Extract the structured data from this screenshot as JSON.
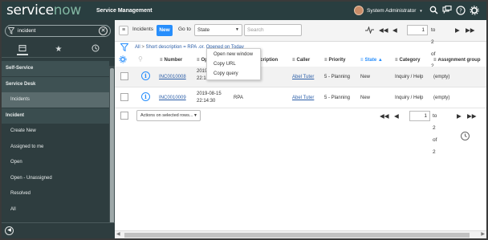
{
  "topbar": {
    "logo_white": "service",
    "logo_green": "now",
    "product": "Service Management",
    "user_name": "System Administrator",
    "user_caret": "▾",
    "icons": [
      "search-icon",
      "chat-icon",
      "help-icon",
      "gear-icon"
    ],
    "brand_colors": {
      "bar": "#293e40",
      "logo_accent": "#81b5a1"
    }
  },
  "sidebar": {
    "filter_value": "incident",
    "tabs": [
      "all-apps-icon",
      "favorites-icon",
      "history-icon"
    ],
    "items": [
      {
        "label": "Self-Service",
        "kind": "section"
      },
      {
        "label": "Service Desk",
        "kind": "section"
      },
      {
        "label": "Incidents",
        "kind": "selected"
      },
      {
        "label": "Incident",
        "kind": "header"
      },
      {
        "label": "Create New",
        "kind": "module"
      },
      {
        "label": "Assigned to me",
        "kind": "module"
      },
      {
        "label": "Open",
        "kind": "module"
      },
      {
        "label": "Open - Unassigned",
        "kind": "module"
      },
      {
        "label": "Resolved",
        "kind": "module"
      },
      {
        "label": "All",
        "kind": "module"
      }
    ]
  },
  "list": {
    "title": "Incidents",
    "new_label": "New",
    "goto_label": "Go to",
    "goto_field": "State",
    "search_placeholder": "Search",
    "page_current": "1",
    "page_total": "to 2 of 2",
    "breadcrumb_all": "All",
    "breadcrumb_sep": ">",
    "breadcrumb_filter": "Short description = RPA .or. Opened on Today",
    "columns": [
      "Number",
      "Opened",
      "Short description",
      "Caller",
      "Priority",
      "State",
      "Category",
      "Assignment group"
    ],
    "sorted_column": "State",
    "rows": [
      {
        "number": "INC0010008",
        "opened_date": "2019-08-15",
        "opened_time": "22:13:49",
        "short_description": "",
        "caller": "Abel Tuter",
        "priority": "5 - Planning",
        "state": "New",
        "category": "Inquiry / Help",
        "assignment_group": "(empty)"
      },
      {
        "number": "INC0010009",
        "opened_date": "2019-08-15",
        "opened_time": "22:14:30",
        "short_description": "RPA",
        "caller": "Abel Tuter",
        "priority": "5 - Planning",
        "state": "New",
        "category": "Inquiry / Help",
        "assignment_group": "(empty)"
      }
    ],
    "actions_label": "Actions on selected rows...",
    "footer_page_current": "1",
    "footer_page_total": "to 2 of 2"
  },
  "context_menu": {
    "items": [
      "Open new window",
      "Copy URL",
      "Copy query"
    ]
  }
}
